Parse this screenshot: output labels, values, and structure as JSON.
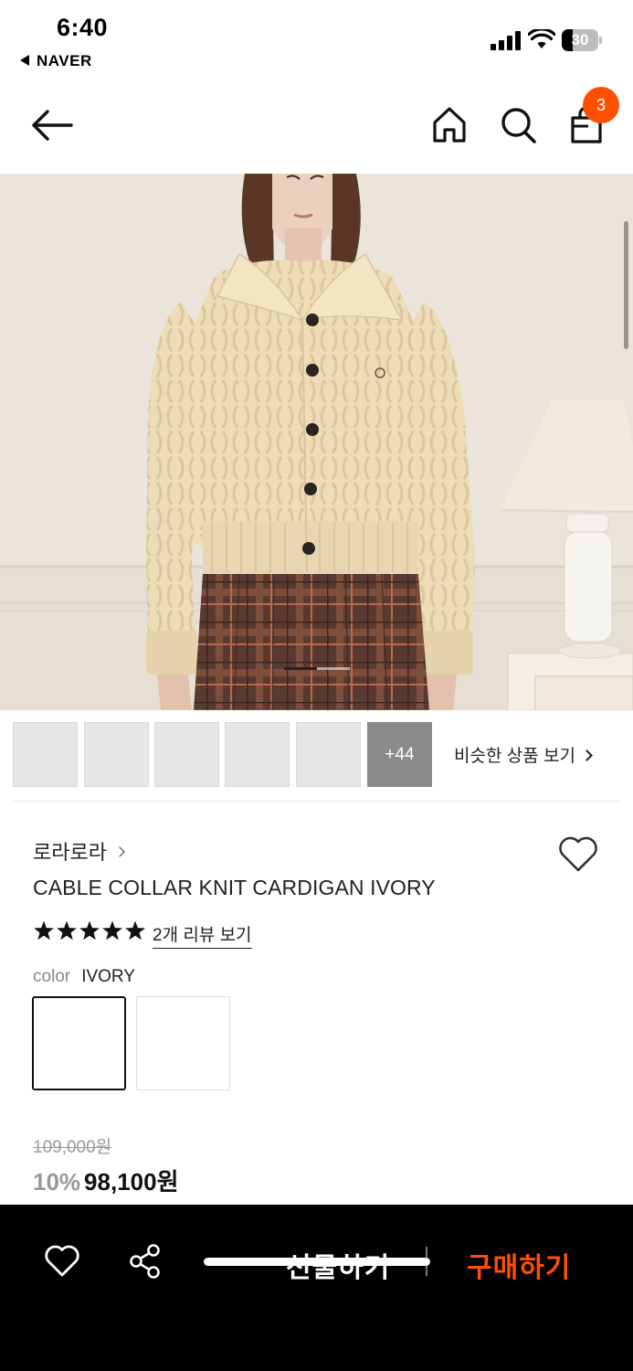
{
  "status_bar": {
    "time": "6:40",
    "back_app": "NAVER",
    "battery": "30",
    "battery_level": 0.3
  },
  "nav": {
    "back_icon": "arrow-left-icon",
    "home_icon": "home-icon",
    "search_icon": "search-icon",
    "cart_icon": "shopping-bag-icon",
    "cart_count": "3"
  },
  "gallery": {
    "more_count": "+44",
    "similar_link": "비슷한 상품 보기",
    "slide_position": 0.5
  },
  "product": {
    "brand": "로라로라",
    "name": "CABLE COLLAR KNIT CARDIGAN IVORY",
    "rating": 5,
    "review_link": "2개 리뷰 보기",
    "color_label": "color",
    "color_value": "IVORY",
    "original_price": "109,000원",
    "discount": "10%",
    "sale_price": "98,100원"
  },
  "bottom_bar": {
    "wish_icon": "heart-icon",
    "share_icon": "share-icon",
    "gift_label": "선물하기",
    "buy_label": "구매하기"
  },
  "colors": {
    "accent": "#ff4f00",
    "bottom_bar_bg": "#000000"
  }
}
